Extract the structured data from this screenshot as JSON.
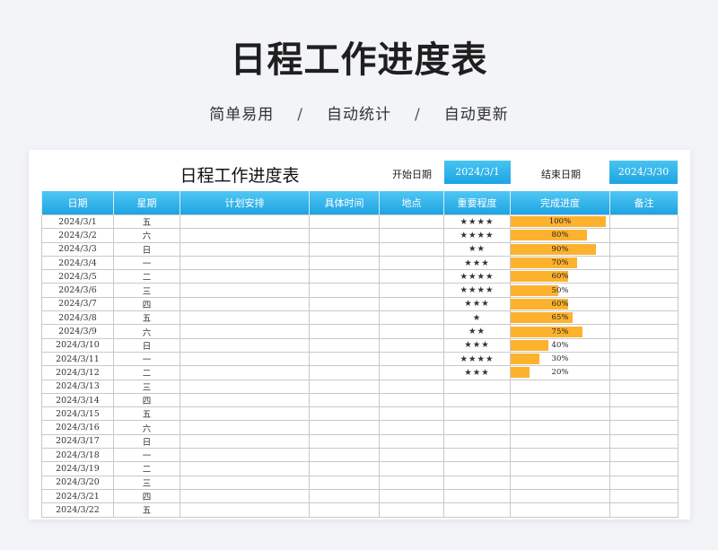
{
  "hero": {
    "title": "日程工作进度表",
    "subtitle_parts": [
      "简单易用",
      "/",
      "自动统计",
      "/",
      "自动更新"
    ]
  },
  "sheet": {
    "title": "日程工作进度表",
    "start_label": "开始日期",
    "start_value": "2024/3/1",
    "end_label": "结束日期",
    "end_value": "2024/3/30"
  },
  "colors": {
    "header": "#1fa3e2",
    "bar": "#fdb22d",
    "star": "#e08a1a"
  },
  "table": {
    "columns": [
      "日期",
      "星期",
      "计划安排",
      "具体时间",
      "地点",
      "重要程度",
      "完成进度",
      "备注"
    ],
    "rows": [
      {
        "date": "2024/3/1",
        "weekday": "五",
        "plan": "",
        "time": "",
        "place": "",
        "stars": "★★★★",
        "progress": 1.0,
        "progress_label": "100%",
        "note": ""
      },
      {
        "date": "2024/3/2",
        "weekday": "六",
        "plan": "",
        "time": "",
        "place": "",
        "stars": "★★★★",
        "progress": 0.8,
        "progress_label": "80%",
        "note": ""
      },
      {
        "date": "2024/3/3",
        "weekday": "日",
        "plan": "",
        "time": "",
        "place": "",
        "stars": "★★",
        "progress": 0.9,
        "progress_label": "90%",
        "note": ""
      },
      {
        "date": "2024/3/4",
        "weekday": "一",
        "plan": "",
        "time": "",
        "place": "",
        "stars": "★★★",
        "progress": 0.7,
        "progress_label": "70%",
        "note": ""
      },
      {
        "date": "2024/3/5",
        "weekday": "二",
        "plan": "",
        "time": "",
        "place": "",
        "stars": "★★★★",
        "progress": 0.6,
        "progress_label": "60%",
        "note": ""
      },
      {
        "date": "2024/3/6",
        "weekday": "三",
        "plan": "",
        "time": "",
        "place": "",
        "stars": "★★★★",
        "progress": 0.5,
        "progress_label": "50%",
        "note": ""
      },
      {
        "date": "2024/3/7",
        "weekday": "四",
        "plan": "",
        "time": "",
        "place": "",
        "stars": "★★★",
        "progress": 0.6,
        "progress_label": "60%",
        "note": ""
      },
      {
        "date": "2024/3/8",
        "weekday": "五",
        "plan": "",
        "time": "",
        "place": "",
        "stars": "★",
        "progress": 0.65,
        "progress_label": "65%",
        "note": ""
      },
      {
        "date": "2024/3/9",
        "weekday": "六",
        "plan": "",
        "time": "",
        "place": "",
        "stars": "★★",
        "progress": 0.75,
        "progress_label": "75%",
        "note": ""
      },
      {
        "date": "2024/3/10",
        "weekday": "日",
        "plan": "",
        "time": "",
        "place": "",
        "stars": "★★★",
        "progress": 0.4,
        "progress_label": "40%",
        "note": ""
      },
      {
        "date": "2024/3/11",
        "weekday": "一",
        "plan": "",
        "time": "",
        "place": "",
        "stars": "★★★★",
        "progress": 0.3,
        "progress_label": "30%",
        "note": ""
      },
      {
        "date": "2024/3/12",
        "weekday": "二",
        "plan": "",
        "time": "",
        "place": "",
        "stars": "★★★",
        "progress": 0.2,
        "progress_label": "20%",
        "note": ""
      },
      {
        "date": "2024/3/13",
        "weekday": "三",
        "plan": "",
        "time": "",
        "place": "",
        "stars": "",
        "progress": null,
        "progress_label": "",
        "note": ""
      },
      {
        "date": "2024/3/14",
        "weekday": "四",
        "plan": "",
        "time": "",
        "place": "",
        "stars": "",
        "progress": null,
        "progress_label": "",
        "note": ""
      },
      {
        "date": "2024/3/15",
        "weekday": "五",
        "plan": "",
        "time": "",
        "place": "",
        "stars": "",
        "progress": null,
        "progress_label": "",
        "note": ""
      },
      {
        "date": "2024/3/16",
        "weekday": "六",
        "plan": "",
        "time": "",
        "place": "",
        "stars": "",
        "progress": null,
        "progress_label": "",
        "note": ""
      },
      {
        "date": "2024/3/17",
        "weekday": "日",
        "plan": "",
        "time": "",
        "place": "",
        "stars": "",
        "progress": null,
        "progress_label": "",
        "note": ""
      },
      {
        "date": "2024/3/18",
        "weekday": "一",
        "plan": "",
        "time": "",
        "place": "",
        "stars": "",
        "progress": null,
        "progress_label": "",
        "note": ""
      },
      {
        "date": "2024/3/19",
        "weekday": "二",
        "plan": "",
        "time": "",
        "place": "",
        "stars": "",
        "progress": null,
        "progress_label": "",
        "note": ""
      },
      {
        "date": "2024/3/20",
        "weekday": "三",
        "plan": "",
        "time": "",
        "place": "",
        "stars": "",
        "progress": null,
        "progress_label": "",
        "note": ""
      },
      {
        "date": "2024/3/21",
        "weekday": "四",
        "plan": "",
        "time": "",
        "place": "",
        "stars": "",
        "progress": null,
        "progress_label": "",
        "note": ""
      },
      {
        "date": "2024/3/22",
        "weekday": "五",
        "plan": "",
        "time": "",
        "place": "",
        "stars": "",
        "progress": null,
        "progress_label": "",
        "note": ""
      }
    ]
  }
}
